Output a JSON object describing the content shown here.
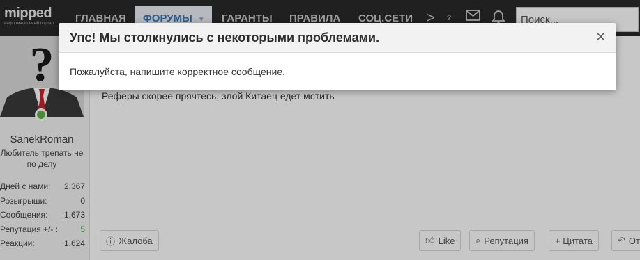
{
  "logo": {
    "name": "mipped",
    "tagline": "информационный портал"
  },
  "nav": {
    "items": [
      {
        "label": "Главная"
      },
      {
        "label": "Форумы"
      },
      {
        "label": "Гаранты"
      },
      {
        "label": "Правила"
      },
      {
        "label": "Соц.сети"
      }
    ],
    "more_glyph": ">",
    "help_glyph": "?",
    "icons": [
      "chevron-right-icon",
      "question-icon",
      "mail-icon",
      "bell-icon"
    ],
    "search": {
      "placeholder": "Поиск...",
      "value": ""
    }
  },
  "user": {
    "name": "SanekRoman",
    "title": "Любитель трепать не по делу",
    "stats": [
      {
        "label": "Дней с нами:",
        "value": "2.367"
      },
      {
        "label": "Розыгрыши:",
        "value": "0"
      },
      {
        "label": "Сообщения:",
        "value": "1.673"
      },
      {
        "label": "Репутация +/- :",
        "value": "5"
      },
      {
        "label": "Реакции:",
        "value": "1.624"
      }
    ]
  },
  "post": {
    "text": "Реферы скорее прячтесь, злой Китаец едет мстить"
  },
  "actions": {
    "report": "Жалоба",
    "like": "Like",
    "reputation": "Репутация",
    "quote": "+ Цитата",
    "reply": "От"
  },
  "modal": {
    "title": "Упс! Мы столкнулись с некоторыми проблемами.",
    "message": "Пожалуйста, напишите корректное сообщение.",
    "close": "×"
  },
  "colors": {
    "accent": "#3a76b5",
    "online": "#5fb34a",
    "positive": "#49a43a",
    "navbar": "#2a2a2a"
  }
}
